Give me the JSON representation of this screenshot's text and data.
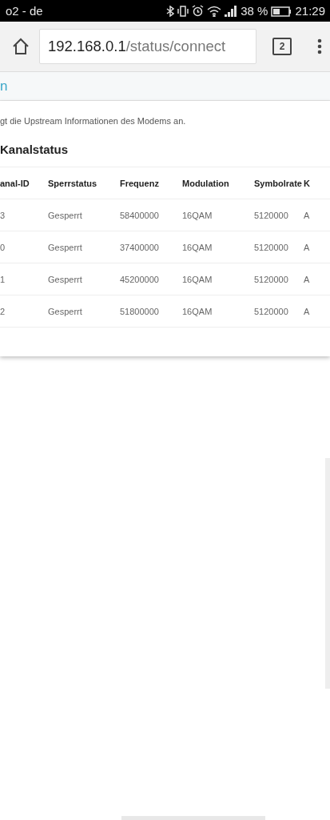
{
  "status_bar": {
    "carrier": "o2 - de",
    "battery": "38 %",
    "time": "21:29"
  },
  "browser": {
    "url_host": "192.168.0.1",
    "url_path": "/status/connect",
    "tab_count": "2"
  },
  "page_header": {
    "title": "n"
  },
  "card": {
    "description": "gt die Upstream Informationen des Modems an.",
    "heading": "Kanalstatus",
    "table": {
      "columns": [
        "anal-ID",
        "Sperrstatus",
        "Frequenz",
        "Modulation",
        "Symbolrate",
        "K"
      ],
      "rows": [
        [
          "3",
          "Gesperrt",
          "58400000",
          "16QAM",
          "5120000",
          "A"
        ],
        [
          "0",
          "Gesperrt",
          "37400000",
          "16QAM",
          "5120000",
          "A"
        ],
        [
          "1",
          "Gesperrt",
          "45200000",
          "16QAM",
          "5120000",
          "A"
        ],
        [
          "2",
          "Gesperrt",
          "51800000",
          "16QAM",
          "5120000",
          "A"
        ]
      ]
    }
  }
}
